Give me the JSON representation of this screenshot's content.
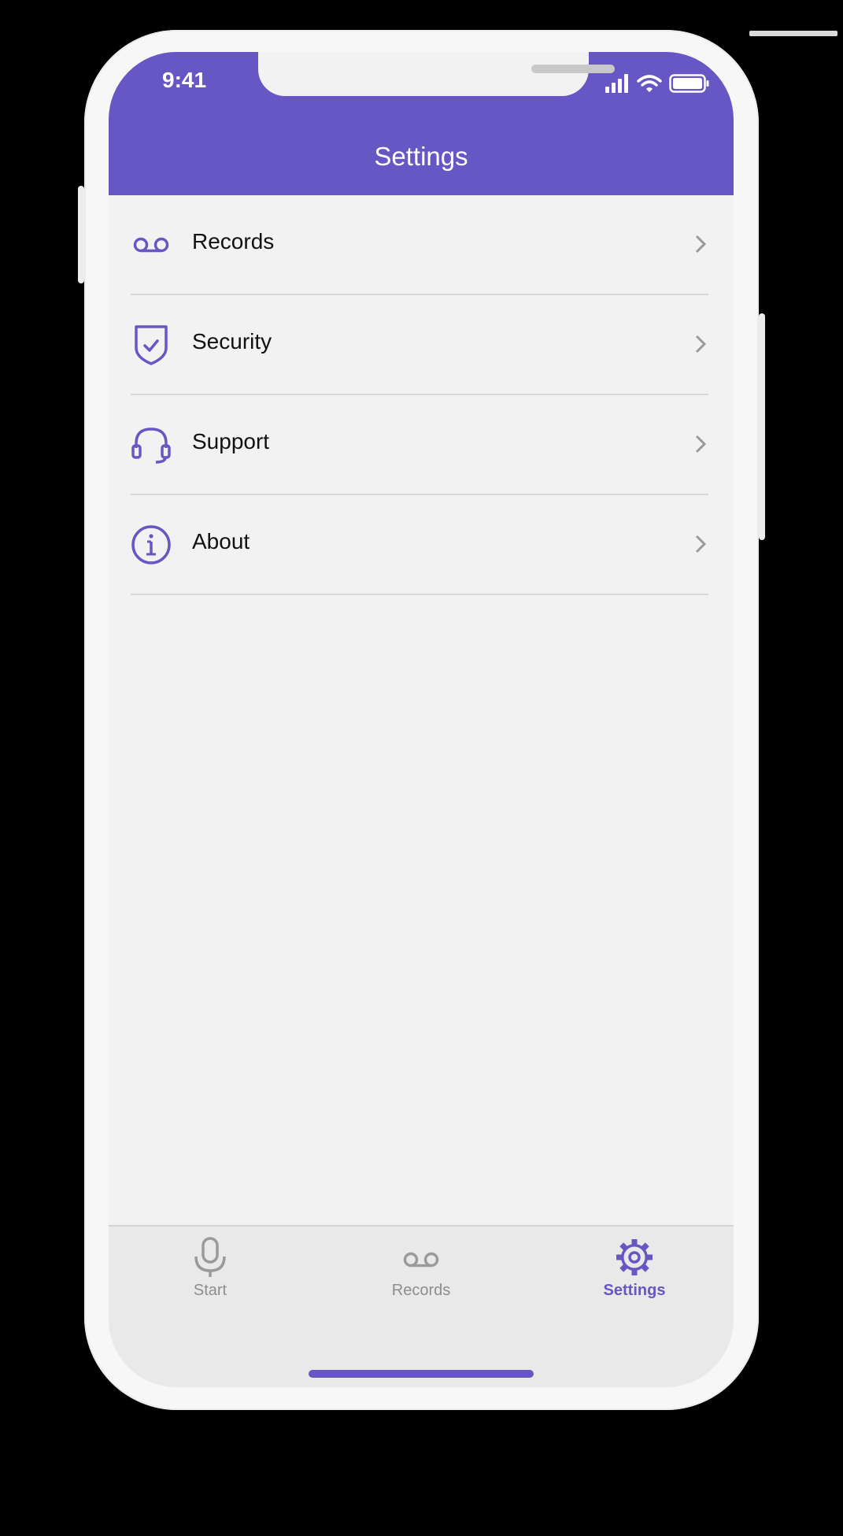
{
  "status_bar": {
    "time": "9:41"
  },
  "header": {
    "title": "Settings"
  },
  "menu": [
    {
      "label": "Records",
      "icon": "voicemail-icon"
    },
    {
      "label": "Security",
      "icon": "shield-check-icon"
    },
    {
      "label": "Support",
      "icon": "headset-icon"
    },
    {
      "label": "About",
      "icon": "info-icon"
    }
  ],
  "tabbar": {
    "items": [
      {
        "label": "Start",
        "icon": "microphone-icon",
        "active": false
      },
      {
        "label": "Records",
        "icon": "voicemail-icon",
        "active": false
      },
      {
        "label": "Settings",
        "icon": "gear-icon",
        "active": true
      }
    ]
  },
  "colors": {
    "accent": "#6757c4",
    "background": "#f2f2f2",
    "inactive": "#8d8d8d"
  }
}
